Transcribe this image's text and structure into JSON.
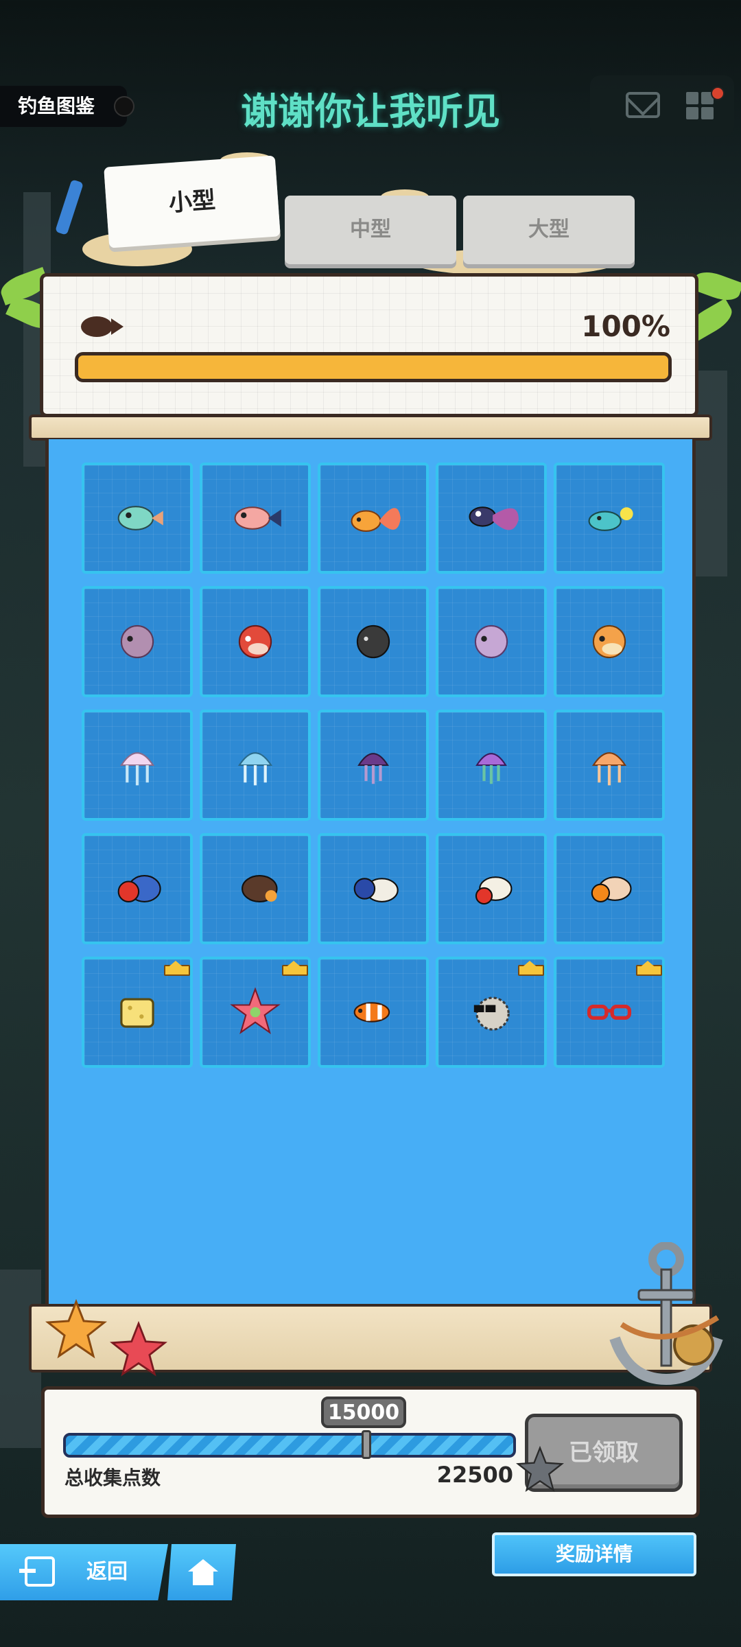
{
  "header": {
    "page_tab": "钓鱼图鉴",
    "song_title": "谢谢你让我听见",
    "icons": [
      "mail-icon",
      "grid-menu-icon"
    ]
  },
  "tabs": [
    {
      "label": "小型",
      "active": true
    },
    {
      "label": "中型",
      "active": false
    },
    {
      "label": "大型",
      "active": false
    }
  ],
  "progress": {
    "percent_label": "100%",
    "value": 1.0
  },
  "collection": [
    {
      "icon": "teal-fish-icon",
      "crown": false
    },
    {
      "icon": "pink-spotted-fish-icon",
      "crown": false
    },
    {
      "icon": "goldfish-icon",
      "crown": false
    },
    {
      "icon": "betta-fish-icon",
      "crown": false
    },
    {
      "icon": "lantern-fish-icon",
      "crown": false
    },
    {
      "icon": "purple-pufferfish-icon",
      "crown": false
    },
    {
      "icon": "red-pufferfish-icon",
      "crown": false
    },
    {
      "icon": "black-pufferfish-icon",
      "crown": false
    },
    {
      "icon": "lilac-pufferfish-icon",
      "crown": false
    },
    {
      "icon": "orange-pufferfish-icon",
      "crown": false
    },
    {
      "icon": "white-jellyfish-icon",
      "crown": false
    },
    {
      "icon": "blue-jellyfish-icon",
      "crown": false
    },
    {
      "icon": "dark-purple-jellyfish-icon",
      "crown": false
    },
    {
      "icon": "violet-jellyfish-icon",
      "crown": false
    },
    {
      "icon": "orange-jellyfish-icon",
      "crown": false
    },
    {
      "icon": "red-hermit-crab-icon",
      "crown": false
    },
    {
      "icon": "brown-hermit-crab-icon",
      "crown": false
    },
    {
      "icon": "blue-hermit-crab-icon",
      "crown": false
    },
    {
      "icon": "white-hermit-crab-icon",
      "crown": false
    },
    {
      "icon": "orange-hermit-crab-icon",
      "crown": false
    },
    {
      "icon": "sponge-icon",
      "crown": true
    },
    {
      "icon": "starfish-icon",
      "crown": true
    },
    {
      "icon": "clownfish-icon",
      "crown": false
    },
    {
      "icon": "sunglasses-pufferfish-icon",
      "crown": true
    },
    {
      "icon": "red-glasses-icon",
      "crown": true
    }
  ],
  "points": {
    "threshold": "15000",
    "label": "总收集点数",
    "total": "22500",
    "fill": 0.67,
    "marker": 0.67,
    "claimed_label": "已领取"
  },
  "footer": {
    "back_label": "返回",
    "rewards_label": "奖励详情"
  },
  "colors": {
    "board": "#47aef6",
    "slot": "#2e8ad4",
    "slot_border": "#36c4ef",
    "progress_fill": "#f6b63a",
    "title": "#5fe0c6"
  }
}
